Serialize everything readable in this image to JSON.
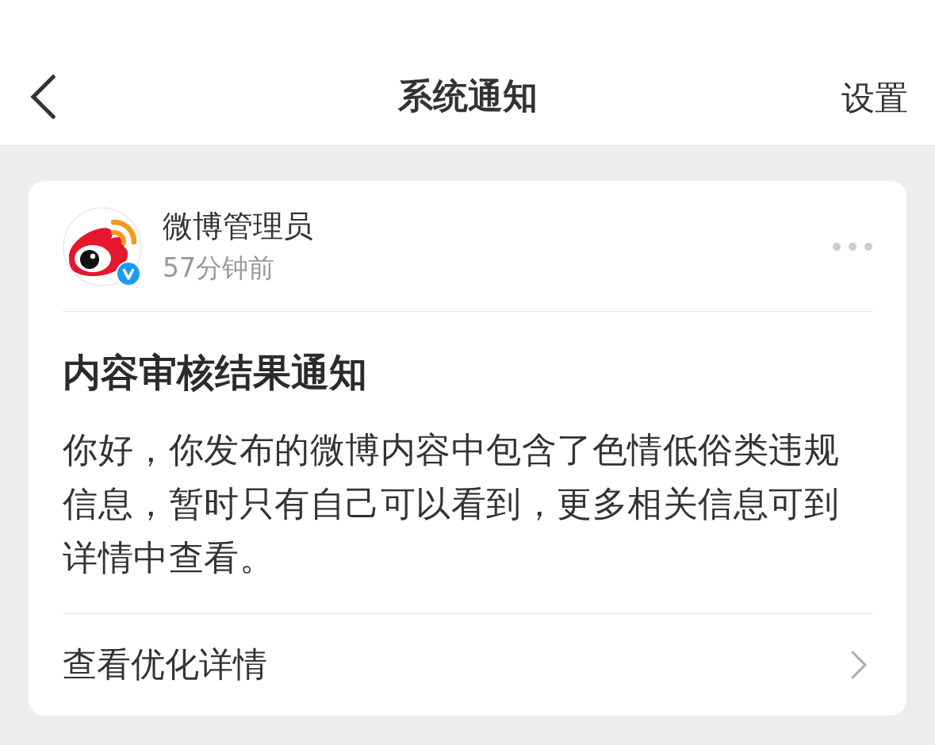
{
  "nav": {
    "title": "系统通知",
    "action": "设置"
  },
  "notice": {
    "sender": {
      "name": "微博管理员",
      "time": "57分钟前",
      "verified": true
    },
    "title": "内容审核结果通知",
    "body": "你好，你发布的微博内容中包含了色情低俗类违规信息，暂时只有自己可以看到，更多相关信息可到详情中查看。",
    "link": "查看优化详情"
  }
}
